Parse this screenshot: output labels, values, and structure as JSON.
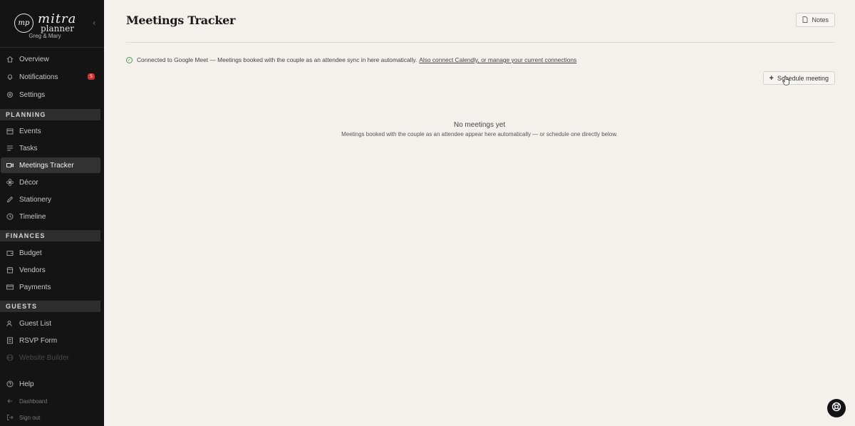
{
  "brand": {
    "logo_initials": "mp",
    "name_line1": "mitra",
    "name_line2": "planner",
    "couple": "Greg & Mary"
  },
  "sidebar": {
    "top_items": [
      {
        "label": "Overview",
        "icon": "home-icon"
      },
      {
        "label": "Notifications",
        "icon": "bell-icon",
        "badge": "5"
      },
      {
        "label": "Settings",
        "icon": "gear-icon"
      }
    ],
    "sections": {
      "planning": "PLANNING",
      "finances": "FINANCES",
      "guests": "GUESTS"
    },
    "planning_items": [
      {
        "label": "Events",
        "icon": "calendar-icon"
      },
      {
        "label": "Tasks",
        "icon": "list-icon"
      },
      {
        "label": "Meetings Tracker",
        "icon": "video-icon",
        "active": true
      },
      {
        "label": "Décor",
        "icon": "flower-icon"
      },
      {
        "label": "Stationery",
        "icon": "pen-icon"
      },
      {
        "label": "Timeline",
        "icon": "clock-icon"
      }
    ],
    "finance_items": [
      {
        "label": "Budget",
        "icon": "wallet-icon"
      },
      {
        "label": "Vendors",
        "icon": "store-icon"
      },
      {
        "label": "Payments",
        "icon": "card-icon"
      }
    ],
    "guest_items": [
      {
        "label": "Guest List",
        "icon": "users-icon"
      },
      {
        "label": "RSVP Form",
        "icon": "form-icon"
      },
      {
        "label": "Website Builder",
        "icon": "globe-icon",
        "disabled": true
      }
    ],
    "bottom_items": [
      {
        "label": "Help",
        "icon": "help-icon"
      },
      {
        "label": "Dashboard",
        "icon": "arrow-left-icon"
      },
      {
        "label": "Sign out",
        "icon": "logout-icon"
      }
    ]
  },
  "header": {
    "title": "Meetings Tracker",
    "notes_label": "Notes"
  },
  "status": {
    "text": "Connected to Google Meet — Meetings booked with the couple as an attendee sync in here automatically.",
    "link": "Also connect Calendly, or manage your current connections"
  },
  "actions": {
    "schedule_label": "Schedule meeting"
  },
  "empty_state": {
    "title": "No meetings yet",
    "subtitle": "Meetings booked with the couple as an attendee appear here automatically — or schedule one directly below."
  }
}
